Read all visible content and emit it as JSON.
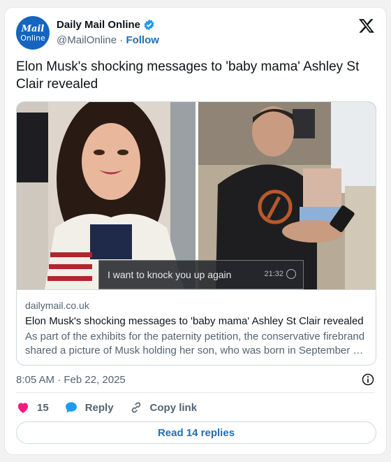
{
  "author": {
    "avatar_line1": "Mail",
    "avatar_line2": "Online",
    "name": "Daily Mail Online",
    "handle": "@MailOnline",
    "separator": "·",
    "follow_label": "Follow",
    "verified_color": "#1d9bf0"
  },
  "tweet": {
    "text": "Elon Musk's shocking messages to 'baby mama' Ashley St Clair revealed",
    "timestamp": "8:05 AM · Feb 22, 2025"
  },
  "link_card": {
    "overlay_message": "I want to knock you up again",
    "overlay_time": "21:32",
    "domain": "dailymail.co.uk",
    "headline": "Elon Musk's shocking messages to 'baby mama' Ashley St Clair revealed",
    "description": "As part of the exhibits for the paternity petition, the conservative firebrand shared a picture of Musk holding her son, who was born in September …"
  },
  "actions": {
    "like_count": "15",
    "reply_label": "Reply",
    "copy_label": "Copy link",
    "like_color": "#f91880",
    "reply_color": "#1d9bf0"
  },
  "replies_button": {
    "label": "Read 14 replies"
  },
  "icons": [
    "verified-badge-icon",
    "x-logo-icon",
    "info-icon",
    "heart-icon",
    "reply-icon",
    "link-icon"
  ]
}
